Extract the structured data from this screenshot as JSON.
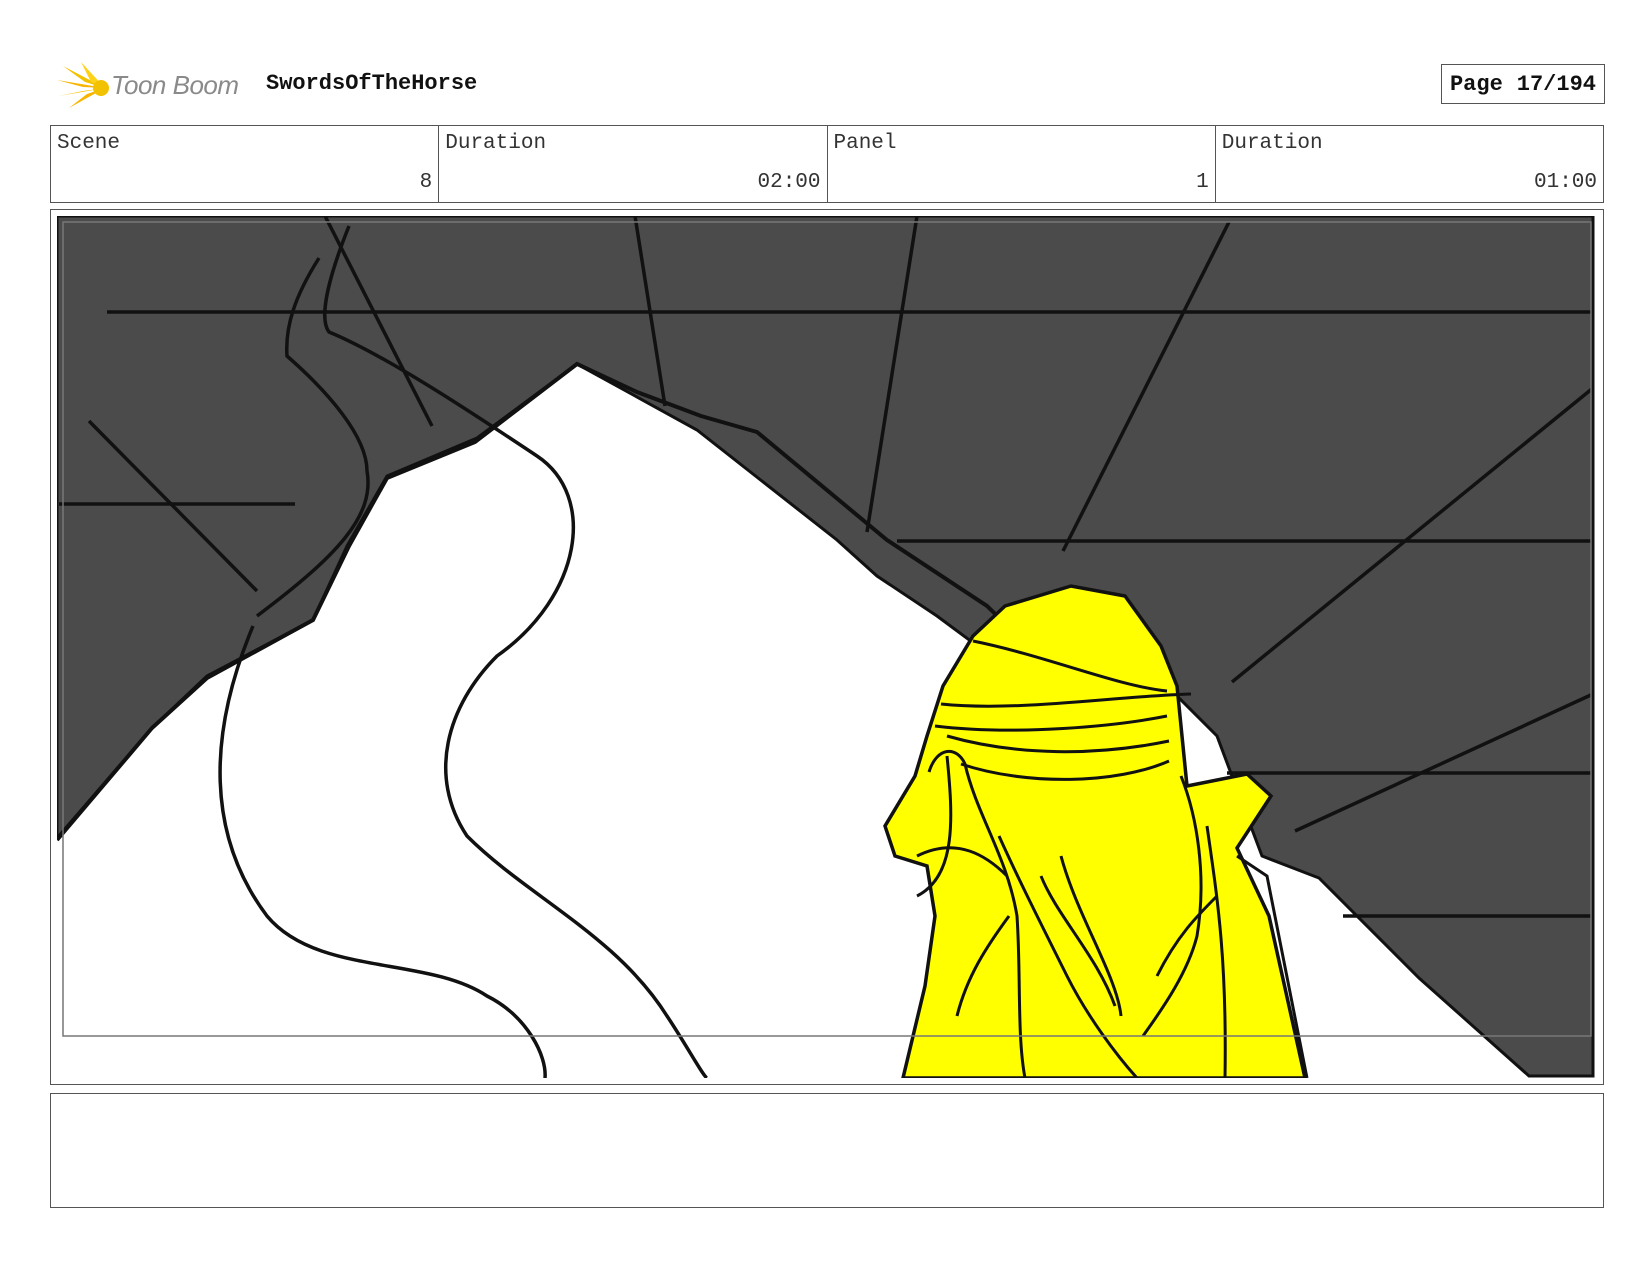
{
  "header": {
    "logo_text": "Toon Boom",
    "project_title": "SwordsOfTheHorse",
    "page_label": "Page",
    "page_number": "17/194"
  },
  "info": {
    "scene_label": "Scene",
    "scene_value": "8",
    "scene_duration_label": "Duration",
    "scene_duration_value": "02:00",
    "panel_label": "Panel",
    "panel_value": "1",
    "panel_duration_label": "Duration",
    "panel_duration_value": "01:00"
  },
  "notes": "",
  "colors": {
    "sky": "#4b4b4b",
    "figure": "#ffff00",
    "ink": "#111111",
    "logo_gold": "#f2c200"
  }
}
